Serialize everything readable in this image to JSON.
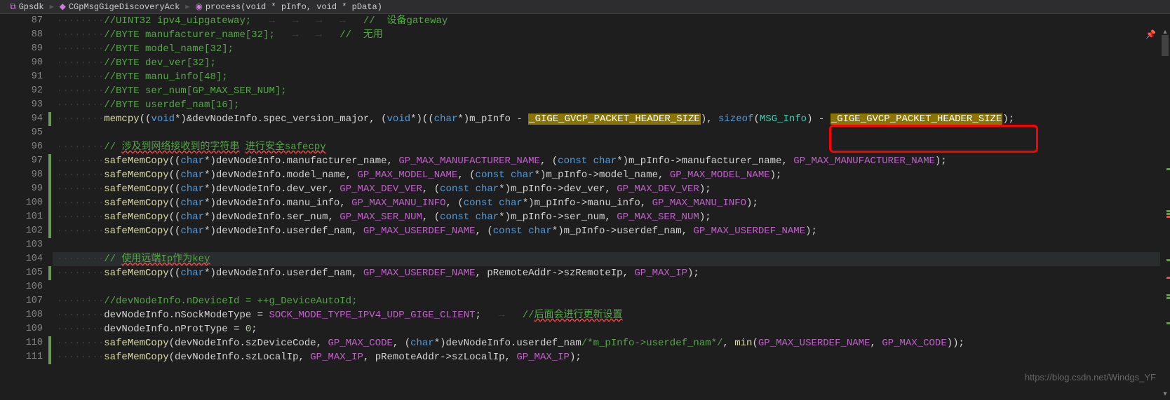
{
  "breadcrumb": {
    "file": "Gpsdk",
    "class": "CGpMsgGigeDiscoveryAck",
    "func": "process(void * pInfo, void * pData)"
  },
  "lines": {
    "start": 87,
    "end": 111
  },
  "watermark": "https://blog.csdn.net/Windgs_YF",
  "code": {
    "l87": "//UINT32 ipv4_uipgateway;                    //  设备gateway",
    "l88": "//BYTE manufacturer_name[32];        //  无用",
    "l89": "//BYTE model_name[32];",
    "l90": "//BYTE dev_ver[32];",
    "l91": "//BYTE manu_info[48];",
    "l92": "//BYTE ser_num[GP_MAX_SER_NUM];",
    "l93": "//BYTE userdef_nam[16];",
    "l94_func": "memcpy",
    "l94_hl1": "_GIGE_GVCP_PACKET_HEADER_SIZE",
    "l94_hl2": "_GIGE_GVCP_PACKET_HEADER_SIZE",
    "l96": "// 涉及到网络接收到的字符串 进行安全safecpy",
    "l97": "safeMemCopy((char*)devNodeInfo.manufacturer_name, GP_MAX_MANUFACTURER_NAME, (const char*)m_pInfo->manufacturer_name, GP_MAX_MANUFACTURER_NAME);",
    "l98": "safeMemCopy((char*)devNodeInfo.model_name, GP_MAX_MODEL_NAME, (const char*)m_pInfo->model_name, GP_MAX_MODEL_NAME);",
    "l99": "safeMemCopy((char*)devNodeInfo.dev_ver, GP_MAX_DEV_VER, (const char*)m_pInfo->dev_ver, GP_MAX_DEV_VER);",
    "l100": "safeMemCopy((char*)devNodeInfo.manu_info, GP_MAX_MANU_INFO, (const char*)m_pInfo->manu_info, GP_MAX_MANU_INFO);",
    "l101": "safeMemCopy((char*)devNodeInfo.ser_num, GP_MAX_SER_NUM, (const char*)m_pInfo->ser_num, GP_MAX_SER_NUM);",
    "l102": "safeMemCopy((char*)devNodeInfo.userdef_nam, GP_MAX_USERDEF_NAME, (const char*)m_pInfo->userdef_nam, GP_MAX_USERDEF_NAME);",
    "l104": "// 使用远端Ip作为key",
    "l105": "safeMemCopy((char*)devNodeInfo.userdef_nam, GP_MAX_USERDEF_NAME, pRemoteAddr->szRemoteIp, GP_MAX_IP);",
    "l107": "//devNodeInfo.nDeviceId = ++g_DeviceAutoId;",
    "l108a": "devNodeInfo.nSockModeType = ",
    "l108b": "SOCK_MODE_TYPE_IPV4_UDP_GIGE_CLIENT",
    "l108c": "//后面会进行更新设置",
    "l109": "devNodeInfo.nProtType = 0;",
    "l110": "safeMemCopy(devNodeInfo.szDeviceCode, GP_MAX_CODE, (char*)devNodeInfo.userdef_nam/*m_pInfo->userdef_nam*/, min(GP_MAX_USERDEF_NAME, GP_MAX_CODE));",
    "l111": "safeMemCopy(devNodeInfo.szLocalIp, GP_MAX_IP, pRemoteAddr->szLocalIp, GP_MAX_IP);"
  }
}
